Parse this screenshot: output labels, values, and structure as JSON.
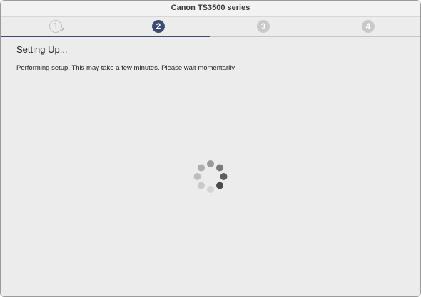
{
  "window": {
    "title": "Canon TS3500 series"
  },
  "steps": {
    "items": [
      {
        "number": "1",
        "state": "done"
      },
      {
        "number": "2",
        "state": "current"
      },
      {
        "number": "3",
        "state": "pending"
      },
      {
        "number": "4",
        "state": "pending"
      }
    ],
    "progress_fraction": 0.5
  },
  "content": {
    "heading": "Setting Up...",
    "message": "Performing setup. This may take a few minutes. Please wait momentarily"
  },
  "spinner": {
    "icon": "loading-spinner-icon"
  },
  "colors": {
    "accent": "#3d4d72",
    "pending": "#c9c9c9",
    "background": "#ececec"
  }
}
